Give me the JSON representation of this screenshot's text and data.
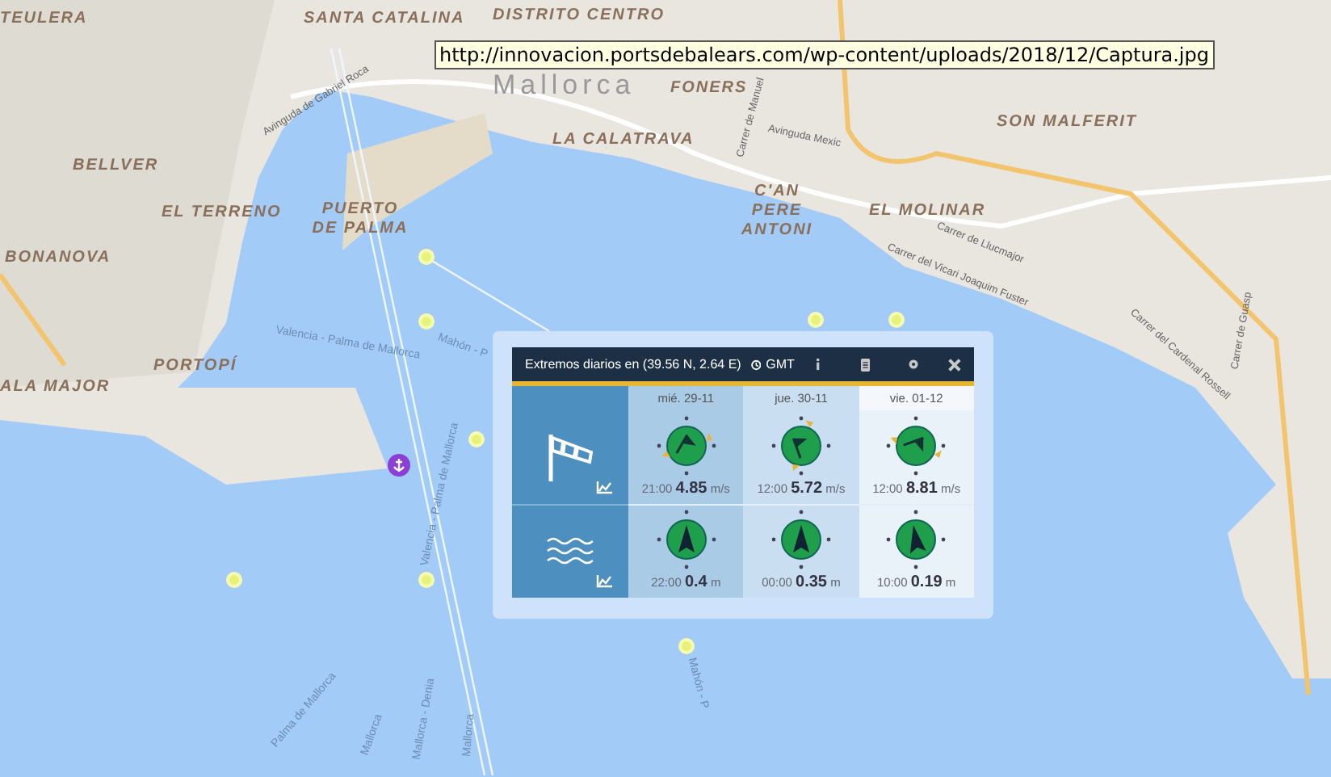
{
  "tooltip": {
    "url": "http://innovacion.portsdebalears.com/wp-content/uploads/2018/12/Captura.jpg"
  },
  "map": {
    "place_labels": [
      "TEULERA",
      "SANTA CATALINA",
      "DISTRITO CENTRO",
      "Mallorca",
      "FONERS",
      "LA CALATRAVA",
      "SON MALFERIT",
      "BELLVER",
      "EL TERRENO",
      "PUERTO DE PALMA",
      "C'AN PERE ANTONI",
      "EL MOLINAR",
      "BONANOVA",
      "PORTOPÍ",
      "ALA MAJOR"
    ],
    "street_labels": [
      "Avinguda de Gabriel Roca",
      "Carrer de Manuel",
      "Avinguda Mexic",
      "Carrer de Llucmajor",
      "Carrer del Vicari Joaquim Fuster",
      "Carrer del Cardenal Rossell",
      "Carrer de Guasp"
    ],
    "route_labels": [
      "Valencia - Palma de Mallorca",
      "Mahón - P",
      "Valencia - Palma de Mallorca",
      "Palma de Mallorca",
      "Mallorca",
      "Mallorca - Denia",
      "Mallorca",
      "Mahón - P"
    ]
  },
  "panel": {
    "title": "Extremos diarios en (39.56 N, 2.64 E)",
    "timezone": "GMT",
    "days": [
      "mié. 29-11",
      "jue. 30-11",
      "vie. 01-12"
    ],
    "rows": [
      {
        "kind": "wind",
        "cells": [
          {
            "time": "21:00",
            "value": "4.85",
            "unit": "m/s"
          },
          {
            "time": "12:00",
            "value": "5.72",
            "unit": "m/s"
          },
          {
            "time": "12:00",
            "value": "8.81",
            "unit": "m/s"
          }
        ]
      },
      {
        "kind": "waves",
        "cells": [
          {
            "time": "22:00",
            "value": "0.4",
            "unit": "m"
          },
          {
            "time": "00:00",
            "value": "0.35",
            "unit": "m"
          },
          {
            "time": "10:00",
            "value": "0.19",
            "unit": "m"
          }
        ]
      }
    ]
  }
}
